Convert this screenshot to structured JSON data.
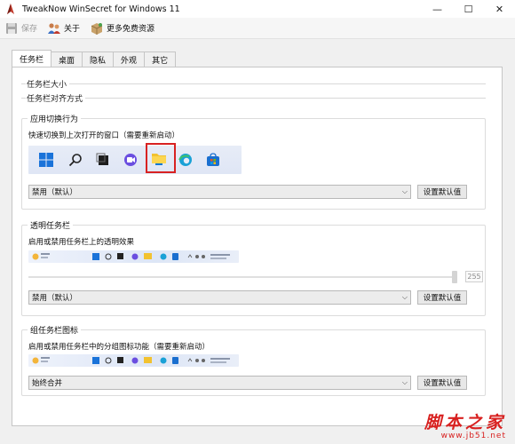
{
  "window": {
    "title": "TweakNow WinSecret for Windows 11",
    "controls": [
      "—",
      "☐",
      "✕"
    ]
  },
  "toolbar": {
    "save_label": "保存",
    "about_label": "关于",
    "more_label": "更多免费资源"
  },
  "tabs": [
    {
      "label": "任务栏"
    },
    {
      "label": "桌面"
    },
    {
      "label": "隐私"
    },
    {
      "label": "外观"
    },
    {
      "label": "其它"
    }
  ],
  "collapsed_groups": [
    {
      "label": "任务栏大小"
    },
    {
      "label": "任务栏对齐方式"
    }
  ],
  "app_switch": {
    "title": "应用切换行为",
    "desc": "快速切换到上次打开的窗口（需要重新启动）",
    "selected": "禁用（默认）",
    "reset_label": "设置默认值"
  },
  "transparency": {
    "title": "透明任务栏",
    "desc": "启用或禁用任务栏上的透明效果",
    "slider_value": "255",
    "slider_fraction": 1.0,
    "selected": "禁用（默认）",
    "reset_label": "设置默认值"
  },
  "grouping": {
    "title": "组任务栏图标",
    "desc": "启用或禁用任务栏中的分组图标功能（需要重新启动）",
    "selected": "始终合并",
    "reset_label": "设置默认值"
  },
  "watermark": {
    "main": "脚本之家",
    "sub": "www.jb51.net"
  },
  "colors": {
    "accent": "#0078d4",
    "highlight": "#d82222",
    "watermark": "#d8201f"
  }
}
